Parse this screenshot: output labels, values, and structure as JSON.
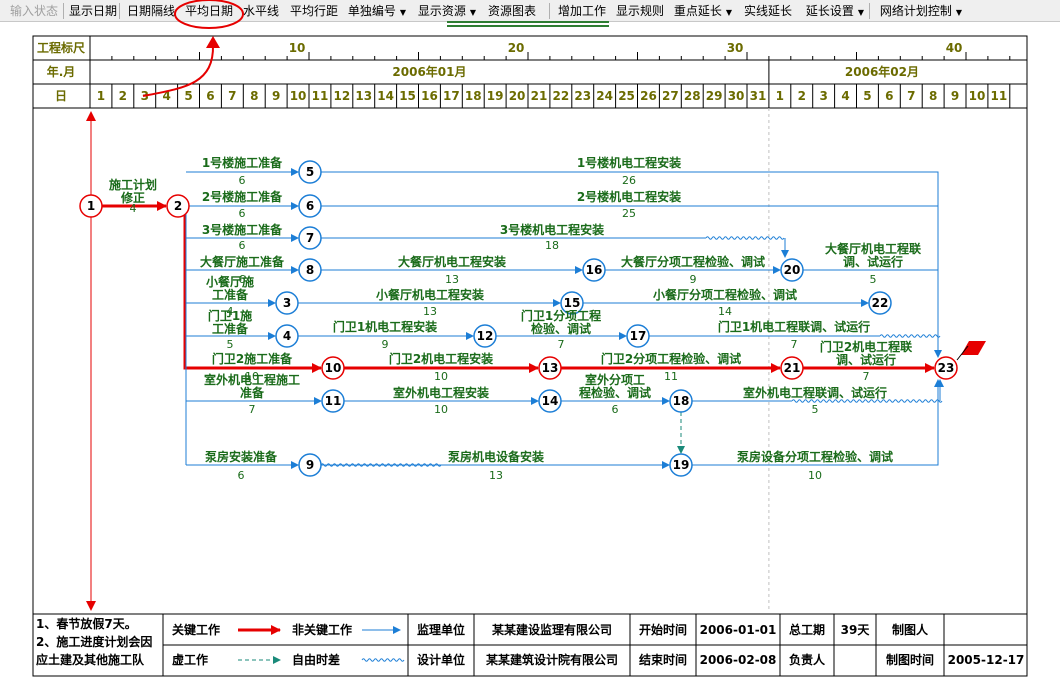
{
  "toolbar": {
    "items": [
      {
        "label": "输入状态",
        "disabled": true
      },
      {
        "label": "显示日期"
      },
      {
        "label": "日期隔线"
      },
      {
        "label": "平均日期",
        "highlighted": true
      },
      {
        "label": "水平线"
      },
      {
        "label": "平均行距"
      },
      {
        "label": "单独编号",
        "dropdown": true
      },
      {
        "label": "显示资源",
        "dropdown": true
      },
      {
        "label": "资源图表"
      },
      {
        "label": "增加工作"
      },
      {
        "label": "显示规则"
      },
      {
        "label": "重点延长",
        "dropdown": true
      },
      {
        "label": "实线延长"
      },
      {
        "label": "延长设置",
        "dropdown": true
      },
      {
        "label": "网络计划控制",
        "dropdown": true
      }
    ]
  },
  "colors": {
    "critical": "#e60000",
    "normal": "#1c7ed6",
    "text": "#1a6b1a",
    "node_text": "#000000",
    "header": "#6b6b00"
  },
  "header": {
    "scale_label": "工程标尺",
    "month_label": "年.月",
    "day_label": "日",
    "scale_ticks": [
      "10",
      "20",
      "30",
      "40"
    ],
    "months": [
      "2006年01月",
      "2006年02月"
    ],
    "days_jan": [
      "1",
      "2",
      "3",
      "4",
      "5",
      "6",
      "7",
      "8",
      "9",
      "10",
      "11",
      "12",
      "13",
      "14",
      "15",
      "16",
      "17",
      "18",
      "19",
      "20",
      "21",
      "22",
      "23",
      "24",
      "25",
      "26",
      "27",
      "28",
      "29",
      "30",
      "31"
    ],
    "days_feb": [
      "1",
      "2",
      "3",
      "4",
      "5",
      "6",
      "7",
      "8",
      "9",
      "10",
      "11"
    ]
  },
  "nodes": [
    "1",
    "2",
    "3",
    "4",
    "5",
    "6",
    "7",
    "8",
    "9",
    "10",
    "11",
    "12",
    "13",
    "14",
    "15",
    "16",
    "17",
    "18",
    "19",
    "20",
    "21",
    "22",
    "23"
  ],
  "tasks": [
    {
      "name": "施工计划修正",
      "dur": "4"
    },
    {
      "name": "1号楼施工准备",
      "dur": "6"
    },
    {
      "name": "1号楼机电工程安装",
      "dur": "26"
    },
    {
      "name": "2号楼施工准备",
      "dur": "6"
    },
    {
      "name": "2号楼机电工程安装",
      "dur": "25"
    },
    {
      "name": "3号楼施工准备",
      "dur": "6"
    },
    {
      "name": "3号楼机电工程安装",
      "dur": "18"
    },
    {
      "name": "大餐厅施工准备",
      "dur": "6"
    },
    {
      "name": "大餐厅机电工程安装",
      "dur": "13"
    },
    {
      "name": "大餐厅分项工程检验、调试",
      "dur": "9"
    },
    {
      "name": "大餐厅机电工程联调、试运行",
      "dur": "5"
    },
    {
      "name": "小餐厅施工准备",
      "dur": "4"
    },
    {
      "name": "小餐厅机电工程安装",
      "dur": "13"
    },
    {
      "name": "小餐厅分项工程检验、调试",
      "dur": "14"
    },
    {
      "name": "门卫1施工准备",
      "dur": "5"
    },
    {
      "name": "门卫1机电工程安装",
      "dur": "9"
    },
    {
      "name": "门卫1分项工程检验、调试",
      "dur": "7"
    },
    {
      "name": "门卫1机电工程联调、试运行",
      "dur": "7"
    },
    {
      "name": "门卫2施工准备",
      "dur": "10"
    },
    {
      "name": "门卫2机电工程安装",
      "dur": "10"
    },
    {
      "name": "门卫2分项工程检验、调试",
      "dur": "11"
    },
    {
      "name": "门卫2机电工程联调、试运行",
      "dur": "7"
    },
    {
      "name": "室外机电工程施工准备",
      "dur": "7"
    },
    {
      "name": "室外机电工程安装",
      "dur": "10"
    },
    {
      "name": "室外分项工程检验、调试",
      "dur": "6"
    },
    {
      "name": "室外机电工程联调、试运行",
      "dur": "5"
    },
    {
      "name": "泵房安装准备",
      "dur": "6"
    },
    {
      "name": "泵房机电设备安装",
      "dur": "13"
    },
    {
      "name": "泵房设备分项工程检验、调试",
      "dur": "10"
    }
  ],
  "footer": {
    "notes": [
      "1、春节放假7天。",
      "2、施工进度计划会因",
      "应土建及其他施工队"
    ],
    "legend": {
      "critical": "关键工作",
      "noncritical": "非关键工作",
      "dummy": "虚工作",
      "float": "自由时差"
    },
    "supervisor_label": "监理单位",
    "supervisor": "某某建设监理有限公司",
    "designer_label": "设计单位",
    "designer": "某某建筑设计院有限公司",
    "start_label": "开始时间",
    "start": "2006-01-01",
    "end_label": "结束时间",
    "end": "2006-02-08",
    "total_label": "总工期",
    "total": "39天",
    "owner_label": "负责人",
    "owner": "",
    "maker_label": "制图人",
    "maker": "",
    "date_label": "制图时间",
    "date": "2005-12-17"
  }
}
